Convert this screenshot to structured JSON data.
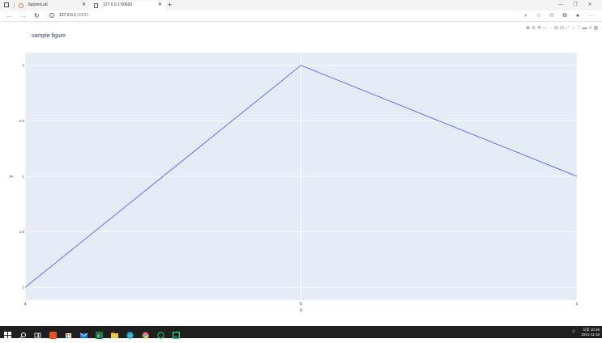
{
  "browser": {
    "tabs": [
      {
        "title": "JupyterLab",
        "active": false
      },
      {
        "title": "127.0.0.1:50693",
        "active": true
      }
    ],
    "address": {
      "host": "127.0.0.1",
      "port": ":50693"
    }
  },
  "chart_data": {
    "type": "line",
    "title": "sample figure",
    "xlabel": "x",
    "ylabel": "y",
    "categories": [
      "a",
      "b",
      "c"
    ],
    "values": [
      1,
      3,
      2
    ],
    "ylim": [
      0.885,
      3.115
    ],
    "yticks": [
      1,
      1.5,
      2,
      2.5,
      3
    ],
    "ytick_labels": [
      "1",
      "1.5",
      "2",
      "2.5",
      "3"
    ],
    "grid": true,
    "line_color": "#636efa",
    "plot_bgcolor": "#e5ecf6",
    "text_color": "#2a3f5f"
  },
  "taskbar": {
    "clock": {
      "time": "오후 10:25",
      "date": "2021-11-16"
    }
  }
}
